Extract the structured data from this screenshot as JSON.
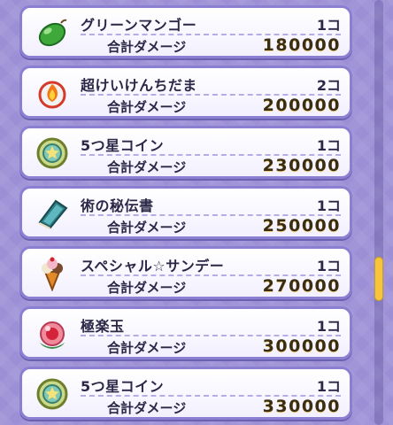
{
  "items": [
    {
      "name": "グリーンマンゴー",
      "qty": "1コ",
      "damage_label": "合計ダメージ",
      "damage": "180000",
      "icon": "green-mango-icon"
    },
    {
      "name": "超けいけんちだま",
      "qty": "2コ",
      "damage_label": "合計ダメージ",
      "damage": "200000",
      "icon": "exp-orb-icon"
    },
    {
      "name": "5つ星コイン",
      "qty": "1コ",
      "damage_label": "合計ダメージ",
      "damage": "230000",
      "icon": "five-star-coin-icon"
    },
    {
      "name": "術の秘伝書",
      "qty": "1コ",
      "damage_label": "合計ダメージ",
      "damage": "250000",
      "icon": "secret-book-icon"
    },
    {
      "name": "スペシャル☆サンデー",
      "qty": "1コ",
      "damage_label": "合計ダメージ",
      "damage": "270000",
      "icon": "special-sundae-icon"
    },
    {
      "name": "極楽玉",
      "qty": "1コ",
      "damage_label": "合計ダメージ",
      "damage": "300000",
      "icon": "paradise-orb-icon"
    },
    {
      "name": "5つ星コイン",
      "qty": "1コ",
      "damage_label": "合計ダメージ",
      "damage": "330000",
      "icon": "five-star-coin-icon"
    }
  ],
  "colors": {
    "background": "#9c8fd6",
    "card_border": "#8a7fd0",
    "scroll_thumb": "#f7c53b"
  }
}
